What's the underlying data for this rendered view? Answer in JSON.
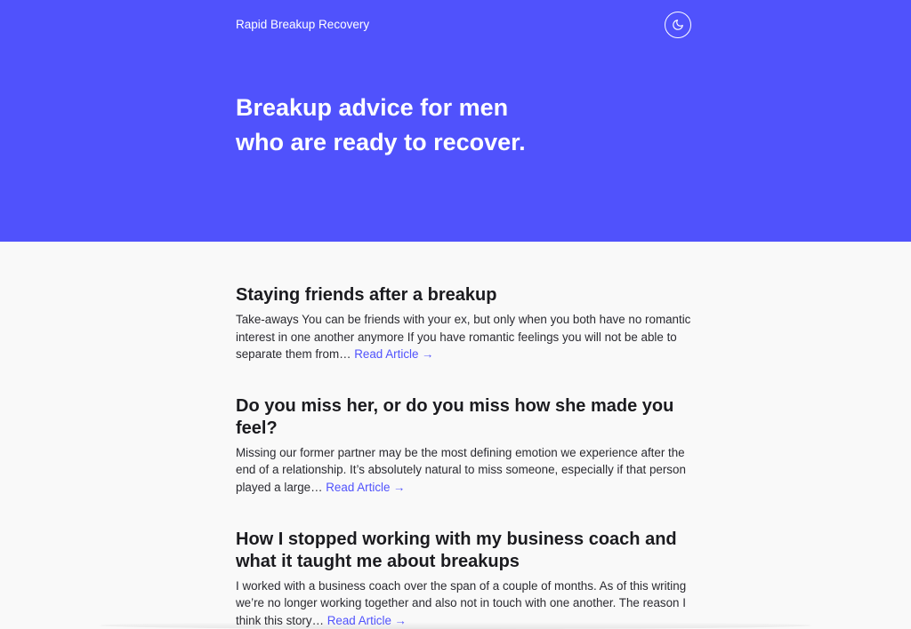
{
  "site": {
    "brand": "Rapid Breakup Recovery"
  },
  "hero": {
    "title": "Breakup advice for men who are ready to recover."
  },
  "theme_toggle": {
    "icon": "moon-icon"
  },
  "posts": [
    {
      "title": "Staying friends after a breakup",
      "excerpt": "Take-aways You can be friends with your ex, but only when you both have no romantic interest in one another anymore If you have romantic feelings you will not be able to separate them from…",
      "link": "Read Article →"
    },
    {
      "title": "Do you miss her, or do you miss how she made you feel?",
      "excerpt": "Missing our former partner may be the most defining emotion we experience after the end of a relationship. It’s absolutely natural to miss someone, especially if that person played a large…",
      "link": "Read Article →"
    },
    {
      "title": "How I stopped working with my business coach and what it taught me about breakups",
      "excerpt": "I worked with a business coach over the span of a couple of months. As of this writing we’re no longer working together and also not in touch with one another. The reason I think this story…",
      "link": "Read Article →"
    }
  ]
}
